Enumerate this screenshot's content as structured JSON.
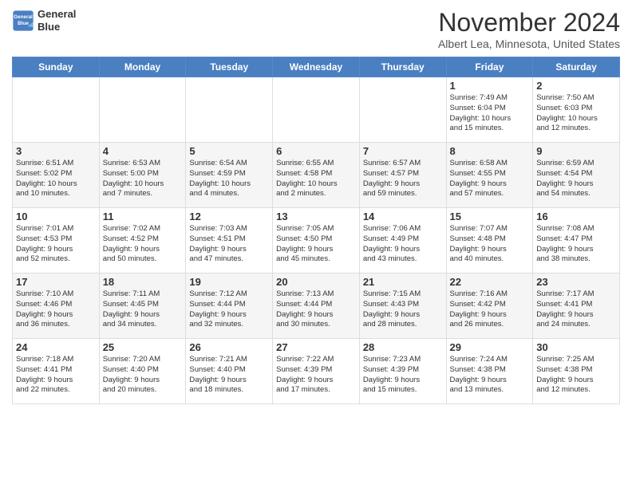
{
  "header": {
    "logo_line1": "General",
    "logo_line2": "Blue",
    "title": "November 2024",
    "location": "Albert Lea, Minnesota, United States"
  },
  "days_of_week": [
    "Sunday",
    "Monday",
    "Tuesday",
    "Wednesday",
    "Thursday",
    "Friday",
    "Saturday"
  ],
  "weeks": [
    [
      {
        "day": "",
        "info": ""
      },
      {
        "day": "",
        "info": ""
      },
      {
        "day": "",
        "info": ""
      },
      {
        "day": "",
        "info": ""
      },
      {
        "day": "",
        "info": ""
      },
      {
        "day": "1",
        "info": "Sunrise: 7:49 AM\nSunset: 6:04 PM\nDaylight: 10 hours\nand 15 minutes."
      },
      {
        "day": "2",
        "info": "Sunrise: 7:50 AM\nSunset: 6:03 PM\nDaylight: 10 hours\nand 12 minutes."
      }
    ],
    [
      {
        "day": "3",
        "info": "Sunrise: 6:51 AM\nSunset: 5:02 PM\nDaylight: 10 hours\nand 10 minutes."
      },
      {
        "day": "4",
        "info": "Sunrise: 6:53 AM\nSunset: 5:00 PM\nDaylight: 10 hours\nand 7 minutes."
      },
      {
        "day": "5",
        "info": "Sunrise: 6:54 AM\nSunset: 4:59 PM\nDaylight: 10 hours\nand 4 minutes."
      },
      {
        "day": "6",
        "info": "Sunrise: 6:55 AM\nSunset: 4:58 PM\nDaylight: 10 hours\nand 2 minutes."
      },
      {
        "day": "7",
        "info": "Sunrise: 6:57 AM\nSunset: 4:57 PM\nDaylight: 9 hours\nand 59 minutes."
      },
      {
        "day": "8",
        "info": "Sunrise: 6:58 AM\nSunset: 4:55 PM\nDaylight: 9 hours\nand 57 minutes."
      },
      {
        "day": "9",
        "info": "Sunrise: 6:59 AM\nSunset: 4:54 PM\nDaylight: 9 hours\nand 54 minutes."
      }
    ],
    [
      {
        "day": "10",
        "info": "Sunrise: 7:01 AM\nSunset: 4:53 PM\nDaylight: 9 hours\nand 52 minutes."
      },
      {
        "day": "11",
        "info": "Sunrise: 7:02 AM\nSunset: 4:52 PM\nDaylight: 9 hours\nand 50 minutes."
      },
      {
        "day": "12",
        "info": "Sunrise: 7:03 AM\nSunset: 4:51 PM\nDaylight: 9 hours\nand 47 minutes."
      },
      {
        "day": "13",
        "info": "Sunrise: 7:05 AM\nSunset: 4:50 PM\nDaylight: 9 hours\nand 45 minutes."
      },
      {
        "day": "14",
        "info": "Sunrise: 7:06 AM\nSunset: 4:49 PM\nDaylight: 9 hours\nand 43 minutes."
      },
      {
        "day": "15",
        "info": "Sunrise: 7:07 AM\nSunset: 4:48 PM\nDaylight: 9 hours\nand 40 minutes."
      },
      {
        "day": "16",
        "info": "Sunrise: 7:08 AM\nSunset: 4:47 PM\nDaylight: 9 hours\nand 38 minutes."
      }
    ],
    [
      {
        "day": "17",
        "info": "Sunrise: 7:10 AM\nSunset: 4:46 PM\nDaylight: 9 hours\nand 36 minutes."
      },
      {
        "day": "18",
        "info": "Sunrise: 7:11 AM\nSunset: 4:45 PM\nDaylight: 9 hours\nand 34 minutes."
      },
      {
        "day": "19",
        "info": "Sunrise: 7:12 AM\nSunset: 4:44 PM\nDaylight: 9 hours\nand 32 minutes."
      },
      {
        "day": "20",
        "info": "Sunrise: 7:13 AM\nSunset: 4:44 PM\nDaylight: 9 hours\nand 30 minutes."
      },
      {
        "day": "21",
        "info": "Sunrise: 7:15 AM\nSunset: 4:43 PM\nDaylight: 9 hours\nand 28 minutes."
      },
      {
        "day": "22",
        "info": "Sunrise: 7:16 AM\nSunset: 4:42 PM\nDaylight: 9 hours\nand 26 minutes."
      },
      {
        "day": "23",
        "info": "Sunrise: 7:17 AM\nSunset: 4:41 PM\nDaylight: 9 hours\nand 24 minutes."
      }
    ],
    [
      {
        "day": "24",
        "info": "Sunrise: 7:18 AM\nSunset: 4:41 PM\nDaylight: 9 hours\nand 22 minutes."
      },
      {
        "day": "25",
        "info": "Sunrise: 7:20 AM\nSunset: 4:40 PM\nDaylight: 9 hours\nand 20 minutes."
      },
      {
        "day": "26",
        "info": "Sunrise: 7:21 AM\nSunset: 4:40 PM\nDaylight: 9 hours\nand 18 minutes."
      },
      {
        "day": "27",
        "info": "Sunrise: 7:22 AM\nSunset: 4:39 PM\nDaylight: 9 hours\nand 17 minutes."
      },
      {
        "day": "28",
        "info": "Sunrise: 7:23 AM\nSunset: 4:39 PM\nDaylight: 9 hours\nand 15 minutes."
      },
      {
        "day": "29",
        "info": "Sunrise: 7:24 AM\nSunset: 4:38 PM\nDaylight: 9 hours\nand 13 minutes."
      },
      {
        "day": "30",
        "info": "Sunrise: 7:25 AM\nSunset: 4:38 PM\nDaylight: 9 hours\nand 12 minutes."
      }
    ]
  ]
}
